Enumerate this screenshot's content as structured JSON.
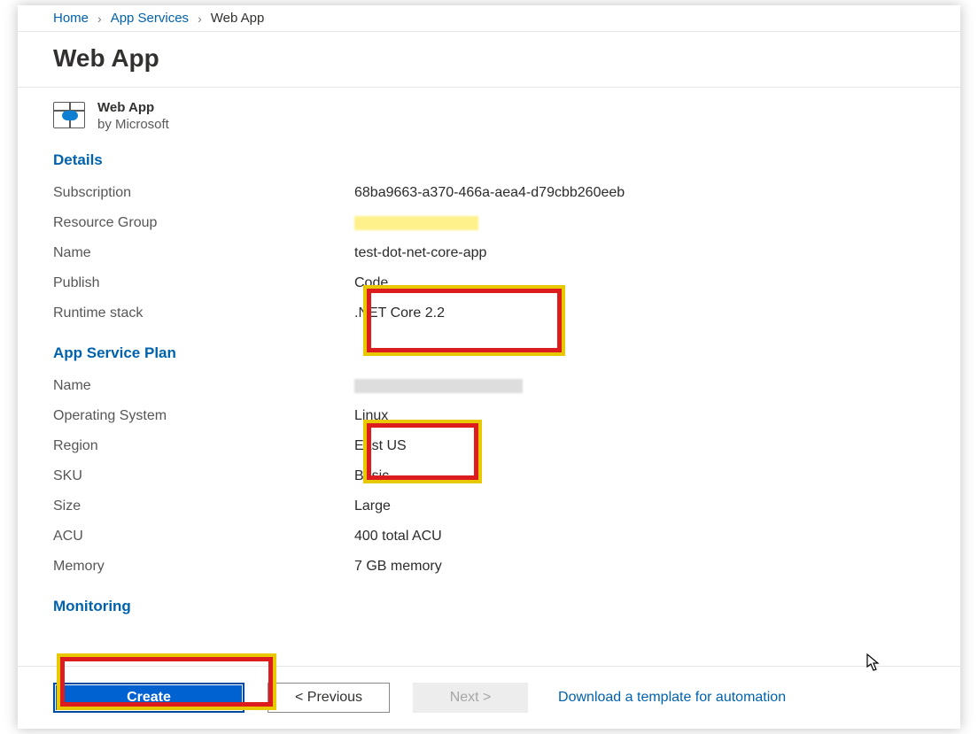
{
  "breadcrumb": {
    "home": "Home",
    "appServices": "App Services",
    "current": "Web App"
  },
  "page_title": "Web App",
  "app_card": {
    "title": "Web App",
    "by": "by Microsoft"
  },
  "sections": {
    "details": "Details",
    "app_service_plan": "App Service Plan",
    "monitoring": "Monitoring"
  },
  "details": {
    "subscription_label": "Subscription",
    "subscription_value": "68ba9663-a370-466a-aea4-d79cbb260eeb",
    "resource_group_label": "Resource Group",
    "name_label": "Name",
    "name_value": "test-dot-net-core-app",
    "publish_label": "Publish",
    "publish_value": "Code",
    "runtime_label": "Runtime stack",
    "runtime_value": ".NET Core 2.2"
  },
  "plan": {
    "name_label": "Name",
    "os_label": "Operating System",
    "os_value": "Linux",
    "region_label": "Region",
    "region_value": "East US",
    "sku_label": "SKU",
    "sku_value": "Basic",
    "size_label": "Size",
    "size_value": "Large",
    "acu_label": "ACU",
    "acu_value": "400 total ACU",
    "memory_label": "Memory",
    "memory_value": "7 GB memory"
  },
  "footer": {
    "create": "Create",
    "previous": "<  Previous",
    "next": "Next  >",
    "download": "Download a template for automation"
  }
}
